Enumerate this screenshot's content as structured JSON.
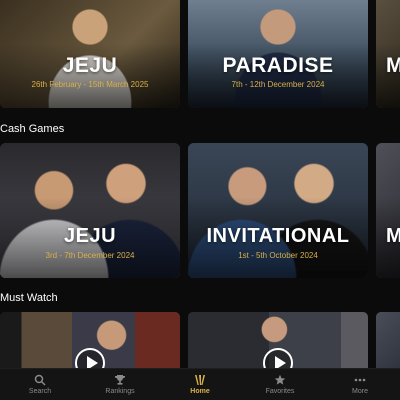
{
  "top_row": [
    {
      "title": "JEJU",
      "dates": "26th February - 15th March 2025",
      "bg": "#5a4a36"
    },
    {
      "title": "PARADISE",
      "dates": "7th - 12th December 2024",
      "bg": "#2b3a4a"
    },
    {
      "title": "M",
      "dates": "",
      "bg": "#4a4030"
    }
  ],
  "cash_games": {
    "label": "Cash Games",
    "cards": [
      {
        "title": "JEJU",
        "dates": "3rd - 7th December 2024",
        "bg": "#4b4b55"
      },
      {
        "title": "INVITATIONAL",
        "dates": "1st - 5th October 2024",
        "bg": "#2f3948"
      },
      {
        "title": "M",
        "dates": "",
        "bg": "#3a3a40"
      }
    ]
  },
  "must_watch": {
    "label": "Must Watch"
  },
  "tabbar": {
    "items": [
      {
        "label": "Search",
        "icon": "search-icon"
      },
      {
        "label": "Rankings",
        "icon": "trophy-icon"
      },
      {
        "label": "Home",
        "icon": "home-logo-icon",
        "active": true
      },
      {
        "label": "Favorites",
        "icon": "star-icon"
      },
      {
        "label": "More",
        "icon": "more-icon"
      }
    ]
  },
  "colors": {
    "accent": "#d9b04a",
    "background": "#0b0b0b",
    "tabbar": "#141414"
  }
}
